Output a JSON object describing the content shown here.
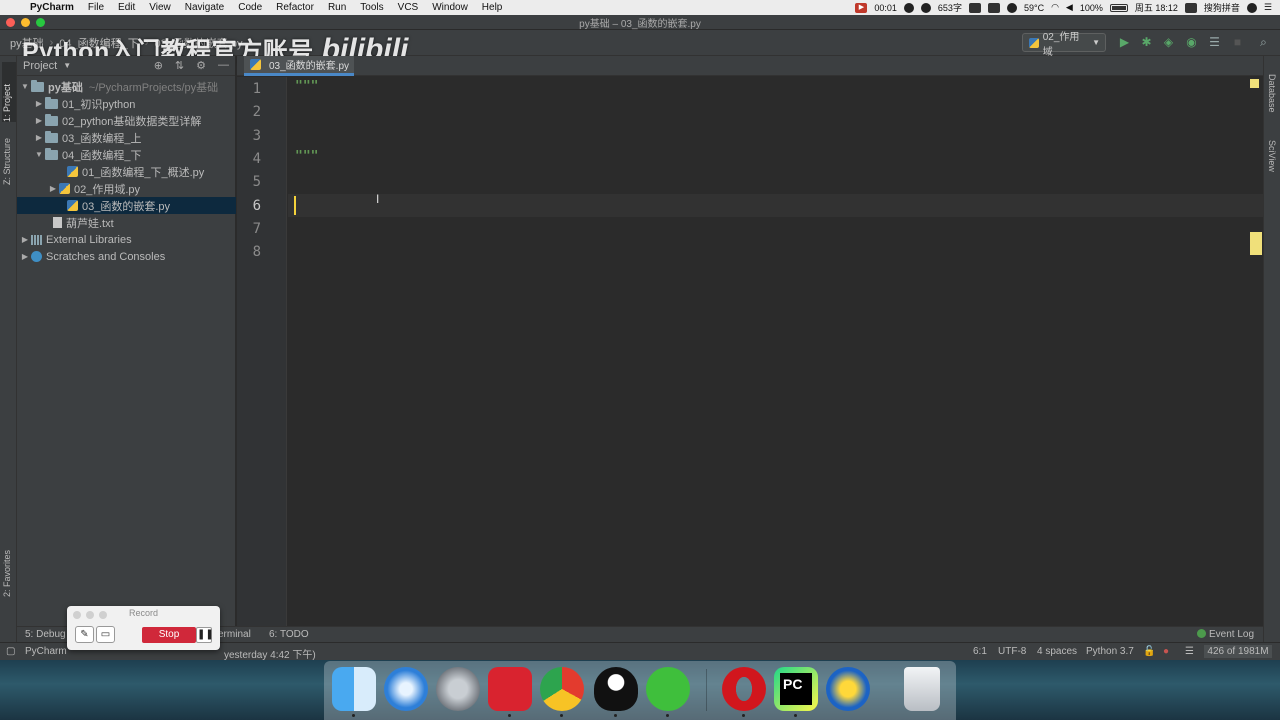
{
  "menubar": {
    "app_name": "PyCharm",
    "menus": [
      "File",
      "Edit",
      "View",
      "Navigate",
      "Code",
      "Refactor",
      "Run",
      "Tools",
      "VCS",
      "Window",
      "Help"
    ],
    "clock_badge": "00:01",
    "word_count": "653字",
    "temp": "59°C",
    "battery": "100%",
    "datetime": "周五 18:12",
    "input_method": "搜狗拼音"
  },
  "window": {
    "title": "py基础 – 03_函数的嵌套.py"
  },
  "navbar": {
    "crumbs": [
      "py基础",
      "04_函数编程_下",
      "03_函数的嵌套.py"
    ]
  },
  "toolbar": {
    "run_config": "02_作用域"
  },
  "watermark": {
    "text": "Python入门教程官方账号",
    "logo": "bilibili"
  },
  "left_tabs": {
    "project": "1: Project",
    "structure": "Z: Structure",
    "favorites": "2: Favorites"
  },
  "right_tabs": {
    "database": "Database",
    "sciview": "SciView"
  },
  "project_panel": {
    "header": "Project",
    "root": {
      "name": "py基础",
      "path": "~/PycharmProjects/py基础"
    },
    "items": [
      {
        "label": "01_初识python"
      },
      {
        "label": "02_python基础数据类型详解"
      },
      {
        "label": "03_函数编程_上"
      },
      {
        "label": "04_函数编程_下"
      },
      {
        "label": "01_函数编程_下_概述.py"
      },
      {
        "label": "02_作用域.py"
      },
      {
        "label": "03_函数的嵌套.py"
      },
      {
        "label": "葫芦娃.txt"
      },
      {
        "label": "External Libraries"
      },
      {
        "label": "Scratches and Consoles"
      }
    ]
  },
  "editor": {
    "tab_label": "03_函数的嵌套.py",
    "line_numbers": [
      "1",
      "2",
      "3",
      "4",
      "5",
      "6",
      "7",
      "8"
    ],
    "lines": [
      "\"\"\"",
      "",
      "",
      "\"\"\"",
      "",
      "",
      "",
      ""
    ]
  },
  "tool_windows": {
    "debug": "5: Debug",
    "terminal": "Terminal",
    "todo": "6: TODO",
    "event_log": "Event Log"
  },
  "status": {
    "app": "PyCharm",
    "message": "yesterday 4:42 下午)",
    "position": "6:1",
    "encoding": "UTF-8",
    "indent": "4 spaces",
    "interpreter": "Python 3.7",
    "memory": "426 of 1981M"
  },
  "record": {
    "title": "Record",
    "stop": "Stop"
  },
  "dock": {
    "apps": [
      "finder-icon",
      "safari-icon",
      "launchpad-icon",
      "netease-music-icon",
      "chrome-icon",
      "qq-icon",
      "wechat-icon",
      "opera-icon",
      "pycharm-icon",
      "thunder-icon",
      "trash-icon"
    ],
    "pycharm_label": "PC"
  }
}
